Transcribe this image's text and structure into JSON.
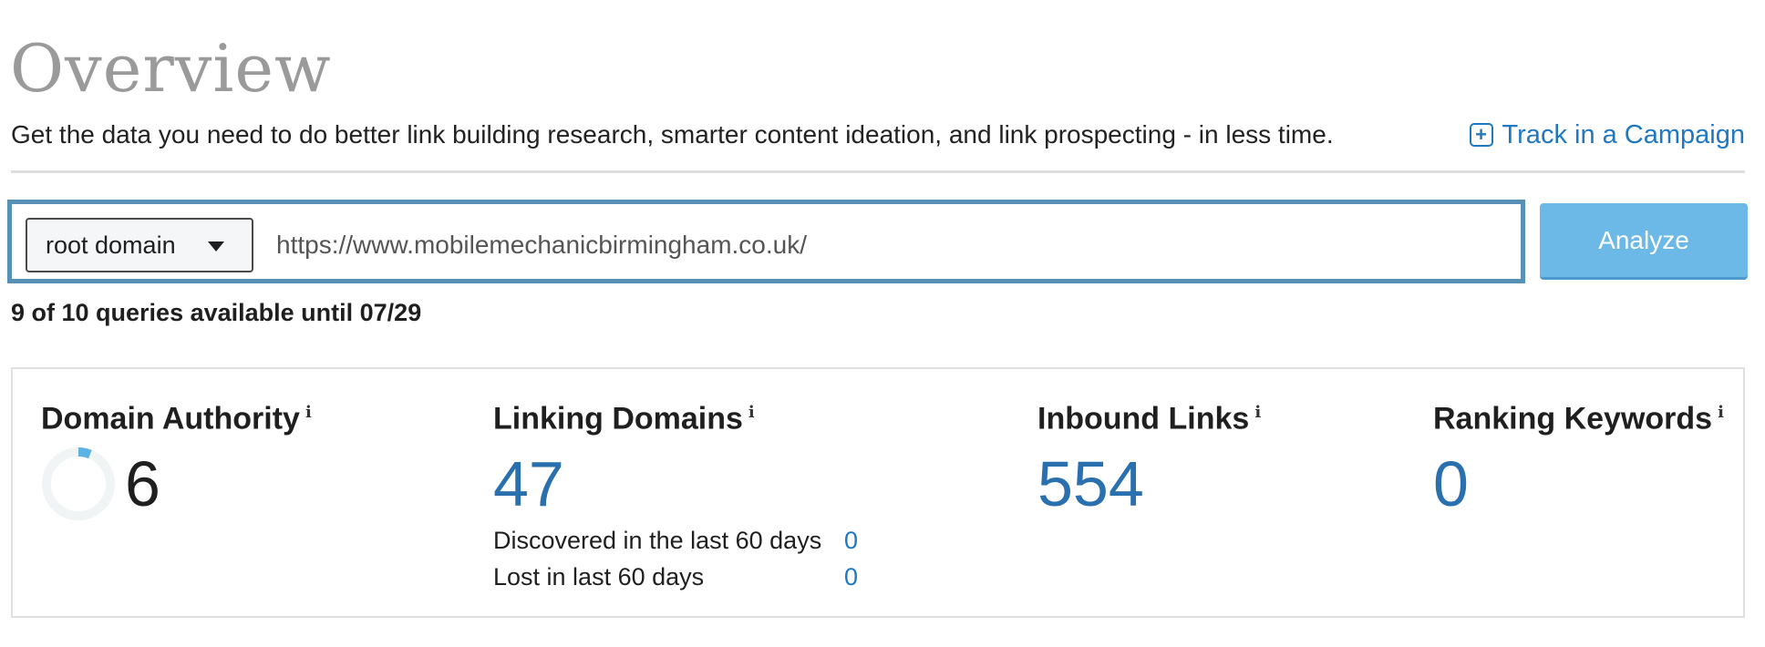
{
  "header": {
    "title": "Overview",
    "subtitle": "Get the data you need to do better link building research, smarter content ideation, and link prospecting - in less time.",
    "track_link": "Track in a Campaign",
    "track_icon": "plus-square-icon"
  },
  "search": {
    "scope_value": "root domain",
    "url_value": "https://www.mobilemechanicbirmingham.co.uk/",
    "analyze_label": "Analyze",
    "queries_text": "9 of 10 queries available until 07/29"
  },
  "metrics": {
    "domain_authority": {
      "label": "Domain Authority",
      "info": "i",
      "value": "6",
      "max": 100
    },
    "linking_domains": {
      "label": "Linking Domains",
      "info": "i",
      "value": "47",
      "discovered_label": "Discovered in the last 60 days",
      "discovered_value": "0",
      "lost_label": "Lost in last 60 days",
      "lost_value": "0"
    },
    "inbound_links": {
      "label": "Inbound Links",
      "info": "i",
      "value": "554"
    },
    "ranking_keywords": {
      "label": "Ranking Keywords",
      "info": "i",
      "value": "0"
    }
  },
  "colors": {
    "accent_link": "#1f78c1",
    "metric_value": "#2a6fae",
    "analyze_button": "#6cb8e6",
    "search_border": "#5891b8",
    "da_ring_fill": "#5eb3e4",
    "da_ring_track": "#f0f4f4"
  }
}
